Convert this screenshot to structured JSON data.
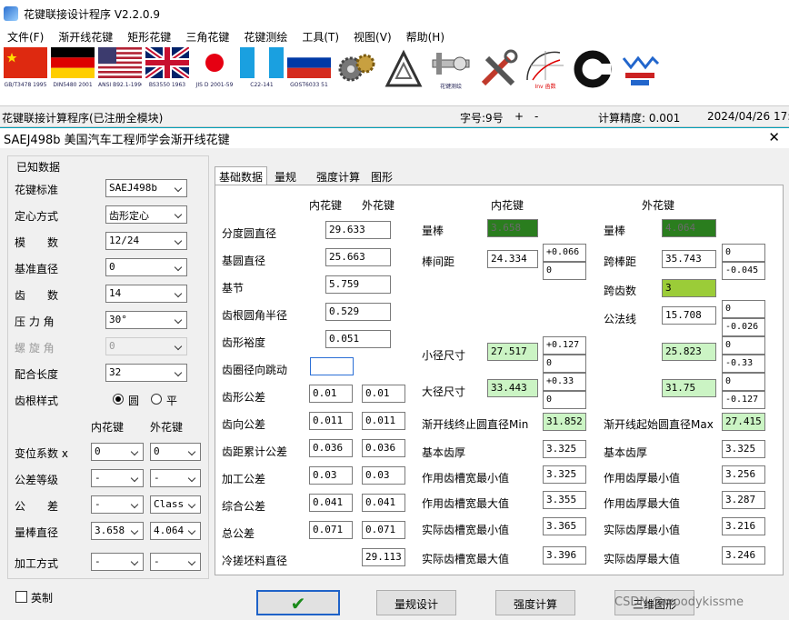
{
  "window": {
    "title": "花键联接设计程序 V2.2.0.9"
  },
  "menu": [
    "文件(F)",
    "渐开线花键",
    "矩形花键",
    "三角花键",
    "花键测绘",
    "工具(T)",
    "视图(V)",
    "帮助(H)"
  ],
  "toolbar": [
    {
      "icon": "china-flag-icon",
      "label": "GB/T3478 1995"
    },
    {
      "icon": "germany-flag-icon",
      "label": "DIN5480 2001"
    },
    {
      "icon": "usa-flag-icon",
      "label": "ANSI B92.1-1996"
    },
    {
      "icon": "uk-flag-icon",
      "label": "BS3550 1963"
    },
    {
      "icon": "japan-flag-icon",
      "label": "JIS D 2001-59"
    },
    {
      "icon": "france-flag-icon",
      "label": "C22-141"
    },
    {
      "icon": "russia-flag-icon",
      "label": "GOST6033 51"
    },
    {
      "icon": "gears-icon",
      "label": ""
    },
    {
      "icon": "triangle-ruler-icon",
      "label": ""
    },
    {
      "icon": "measure-icon",
      "label": "花键测绘"
    },
    {
      "icon": "tools-icon",
      "label": ""
    },
    {
      "icon": "involute-icon",
      "label": "Inv 函数"
    },
    {
      "icon": "ring-icon",
      "label": ""
    },
    {
      "icon": "spline-icon",
      "label": ""
    }
  ],
  "status": {
    "left": "花键联接计算程序(已注册全模块)",
    "font_label": "字号:9号",
    "plus": "+",
    "minus": "-",
    "precision": "计算精度: 0.001",
    "date": "2024/04/26 17:5"
  },
  "dialog": {
    "title": "SAEJ498b 美国汽车工程师学会渐开线花键",
    "close": "✕",
    "known": {
      "group_title": "已知数据",
      "rows": [
        {
          "label": "花键标准",
          "value": "SAEJ498b"
        },
        {
          "label": "定心方式",
          "value": "齿形定心"
        },
        {
          "label": "模　　数",
          "value": "12/24"
        },
        {
          "label": "基准直径",
          "value": "0"
        },
        {
          "label": "齿　　数",
          "value": "14"
        },
        {
          "label": "压 力 角",
          "value": "30°"
        },
        {
          "label": "螺 旋 角",
          "value": "0"
        },
        {
          "label": "配合长度",
          "value": "32"
        }
      ],
      "root_label": "齿根样式",
      "root_opt1": "圆",
      "root_opt2": "平",
      "col_int": "内花键",
      "col_ext": "外花键",
      "rows2": [
        {
          "label": "变位系数 x",
          "int": "0",
          "ext": "0"
        },
        {
          "label": "公差等级",
          "int": "-",
          "ext": "-"
        },
        {
          "label": "公　　差",
          "int": "-",
          "ext": "Class"
        },
        {
          "label": "量棒直径",
          "int": "3.658",
          "ext": "4.064"
        },
        {
          "label": "加工方式",
          "int": "-",
          "ext": "-"
        }
      ],
      "english": "英制"
    },
    "tabs": [
      "基础数据",
      "量规",
      "强度计算",
      "图形"
    ],
    "basic": {
      "h_int": "内花键",
      "h_ext": "外花键",
      "pitch_dia_label": "分度圆直径",
      "pitch_dia": "29.633",
      "base_dia_label": "基圆直径",
      "base_dia": "25.663",
      "pitch_label": "基节",
      "pitch": "5.759",
      "fillet_label": "齿根圆角半径",
      "fillet": "0.529",
      "clear_label": "齿形裕度",
      "clear": "0.051",
      "runout_label": "齿圈径向跳动",
      "runout": "",
      "tol": [
        {
          "label": "齿形公差",
          "int": "0.01",
          "ext": "0.01"
        },
        {
          "label": "齿向公差",
          "int": "0.011",
          "ext": "0.011"
        },
        {
          "label": "齿距累计公差",
          "int": "0.036",
          "ext": "0.036"
        },
        {
          "label": "加工公差",
          "int": "0.03",
          "ext": "0.03"
        },
        {
          "label": "综合公差",
          "int": "0.041",
          "ext": "0.041"
        },
        {
          "label": "总公差",
          "int": "0.071",
          "ext": "0.071"
        }
      ],
      "blank_label": "冷搓坯料直径",
      "blank": "29.113"
    },
    "meas": {
      "h_int": "内花键",
      "h_ext": "外花键",
      "pin_label": "量棒",
      "pin_int": "3.658",
      "pin_ext": "4.064",
      "bw_label": "棒间距",
      "bw": "24.334",
      "bw_up": "+0.066",
      "bw_lo": "0",
      "ob_label": "跨棒距",
      "ob": "35.743",
      "ob_up": "0",
      "ob_lo": "-0.045",
      "span_label": "跨齿数",
      "span": "3",
      "wk_label": "公法线",
      "wk": "15.708",
      "wk_up": "0",
      "wk_lo": "-0.026",
      "minor_label": "小径尺寸",
      "minor_int": "27.517",
      "minor_int_up": "+0.127",
      "minor_int_lo": "0",
      "minor_ext": "25.823",
      "minor_ext_up": "0",
      "minor_ext_lo": "-0.33",
      "major_label": "大径尺寸",
      "major_int": "33.443",
      "major_int_up": "+0.33",
      "major_int_lo": "0",
      "major_ext": "31.75",
      "major_ext_up": "0",
      "major_ext_lo": "-0.127",
      "inv_end_label": "渐开线终止圆直径Min",
      "inv_end": "31.852",
      "inv_start_label": "渐开线起始圆直径Max",
      "inv_start": "27.415",
      "space_basic_label": "基本齿厚",
      "space_basic": "3.325",
      "tooth_basic_label": "基本齿厚",
      "tooth_basic": "3.325",
      "eff_space_min_label": "作用齿槽宽最小值",
      "eff_space_min": "3.325",
      "eff_tooth_min_label": "作用齿厚最小值",
      "eff_tooth_min": "3.256",
      "eff_space_max_label": "作用齿槽宽最大值",
      "eff_space_max": "3.355",
      "eff_tooth_max_label": "作用齿厚最大值",
      "eff_tooth_max": "3.287",
      "act_space_min_label": "实际齿槽宽最小值",
      "act_space_min": "3.365",
      "act_tooth_min_label": "实际齿厚最小值",
      "act_tooth_min": "3.216",
      "act_space_max_label": "实际齿槽宽最大值",
      "act_space_max": "3.396",
      "act_tooth_max_label": "实际齿厚最大值",
      "act_tooth_max": "3.246"
    },
    "buttons": {
      "ok": "✔",
      "gauge": "量规设计",
      "strength": "强度计算",
      "view3d": "三维图形"
    },
    "watermark": "CSDN @woodykissme"
  }
}
